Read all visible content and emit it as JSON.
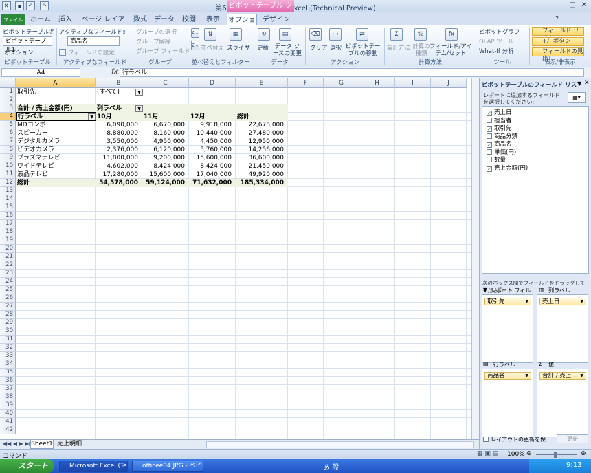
{
  "window": {
    "title": "第6章.xlsx - Microsoft Excel (Technical Preview)",
    "context_tab_group": "ピボットテーブル ツール",
    "file_tab": "ファイル"
  },
  "tabs": [
    "ホーム",
    "挿入",
    "ページ レイアウト",
    "数式",
    "データ",
    "校閲",
    "表示",
    "オプション",
    "デザイン"
  ],
  "ribbon": {
    "groups": {
      "pivottable": "ピボットテーブル",
      "active_field": "アクティブなフィールド",
      "group": "グループ",
      "sort_filter": "並べ替えとフィルター",
      "data": "データ",
      "actions": "アクション",
      "calc": "計算方法",
      "tools": "ツール",
      "show_hide": "表示/非表示"
    },
    "pivottable_name_label": "ピボットテーブル名:",
    "pivottable_name_value": "ピボットテーブル1",
    "options_label": "オプション",
    "active_field_label": "アクティブなフィールド:",
    "active_field_value": "商品名",
    "field_settings": "フィールドの設定",
    "group_selection": "グループの選択",
    "ungroup": "グループ解除",
    "group_field": "グループ フィールド",
    "sort": "並べ替え",
    "slicer": "スライサー",
    "refresh": "更新",
    "change_source": "データ ソースの変更",
    "clear": "クリア",
    "select": "選択",
    "move_pivot": "ピボットテーブルの移動",
    "summarize": "集計方法",
    "show_values": "計算の種類",
    "fields_items": "フィールド/アイテム/セット",
    "pivot_chart": "ピボットグラフ",
    "olap_tools": "OLAP ツール",
    "what_if": "What-If 分析",
    "field_list": "フィールド リスト",
    "plus_minus": "+/- ボタン",
    "field_headers": "フィールドの見出し"
  },
  "formula_bar": {
    "name_box": "A4",
    "fx": "fx",
    "formula": "行ラベル"
  },
  "columns": [
    "A",
    "B",
    "C",
    "D",
    "E",
    "F",
    "G",
    "H",
    "I",
    "J"
  ],
  "rows": [
    "1",
    "2",
    "3",
    "4",
    "5",
    "6",
    "7",
    "8",
    "9",
    "10",
    "11",
    "12",
    "13",
    "14",
    "15",
    "16",
    "17",
    "18",
    "19",
    "20",
    "21",
    "22",
    "23",
    "24",
    "25",
    "26",
    "27",
    "28",
    "29",
    "30",
    "31",
    "32",
    "33",
    "34",
    "35",
    "36",
    "37",
    "38",
    "39",
    "40",
    "41",
    "42"
  ],
  "pivot": {
    "filter_label": "取引先",
    "filter_value": "(すべて)",
    "value_header": "合計 / 売上金額(円)",
    "col_labels": "列ラベル",
    "row_labels": "行ラベル",
    "months": [
      "10月",
      "11月",
      "12月",
      "総計"
    ],
    "data_rows": [
      {
        "name": "MDコンポ",
        "values": [
          "6,090,000",
          "6,670,000",
          "9,918,000",
          "22,678,000"
        ]
      },
      {
        "name": "スピーカー",
        "values": [
          "8,880,000",
          "8,160,000",
          "10,440,000",
          "27,480,000"
        ]
      },
      {
        "name": "デジタルカメラ",
        "values": [
          "3,550,000",
          "4,950,000",
          "4,450,000",
          "12,950,000"
        ]
      },
      {
        "name": "ビデオカメラ",
        "values": [
          "2,376,000",
          "6,120,000",
          "5,760,000",
          "14,256,000"
        ]
      },
      {
        "name": "プラズマテレビ",
        "values": [
          "11,800,000",
          "9,200,000",
          "15,600,000",
          "36,600,000"
        ]
      },
      {
        "name": "ワイドテレビ",
        "values": [
          "4,602,000",
          "8,424,000",
          "8,424,000",
          "21,450,000"
        ]
      },
      {
        "name": "液晶テレビ",
        "values": [
          "17,280,000",
          "15,600,000",
          "17,040,000",
          "49,920,000"
        ]
      }
    ],
    "total_label": "総計",
    "totals": [
      "54,578,000",
      "59,124,000",
      "71,632,000",
      "185,334,000"
    ]
  },
  "sheet_tabs": [
    "Sheet1",
    "売上明細"
  ],
  "field_pane": {
    "title": "ピボットテーブルのフィールド リスト",
    "instruction": "レポートに追加するフィールドを選択してください:",
    "fields": [
      {
        "name": "売上日",
        "checked": true
      },
      {
        "name": "担当者",
        "checked": false
      },
      {
        "name": "取引先",
        "checked": true
      },
      {
        "name": "商品分類",
        "checked": false
      },
      {
        "name": "商品名",
        "checked": true
      },
      {
        "name": "単価(円)",
        "checked": false
      },
      {
        "name": "数量",
        "checked": false
      },
      {
        "name": "売上金額(円)",
        "checked": true
      }
    ],
    "drag_instruction": "次のボックス間でフィールドをドラッグしてください:",
    "areas": {
      "report_filter": "レポート フィル...",
      "column_labels": "列ラベル",
      "row_labels": "行ラベル",
      "values": "値"
    },
    "chips": {
      "report_filter": "取引先",
      "column_labels": "売上日",
      "row_labels": "商品名",
      "values": "合計 / 売上..."
    },
    "defer_update": "レイアウトの更新を保...",
    "update_button": "更新"
  },
  "status": {
    "mode": "コマンド",
    "zoom": "100%"
  },
  "taskbar": {
    "start": "スタート",
    "apps": [
      "Microsoft Excel (Tec...",
      "officee04.JPG - ペイ..."
    ],
    "ime": "あ 般",
    "clock": "9:13"
  }
}
